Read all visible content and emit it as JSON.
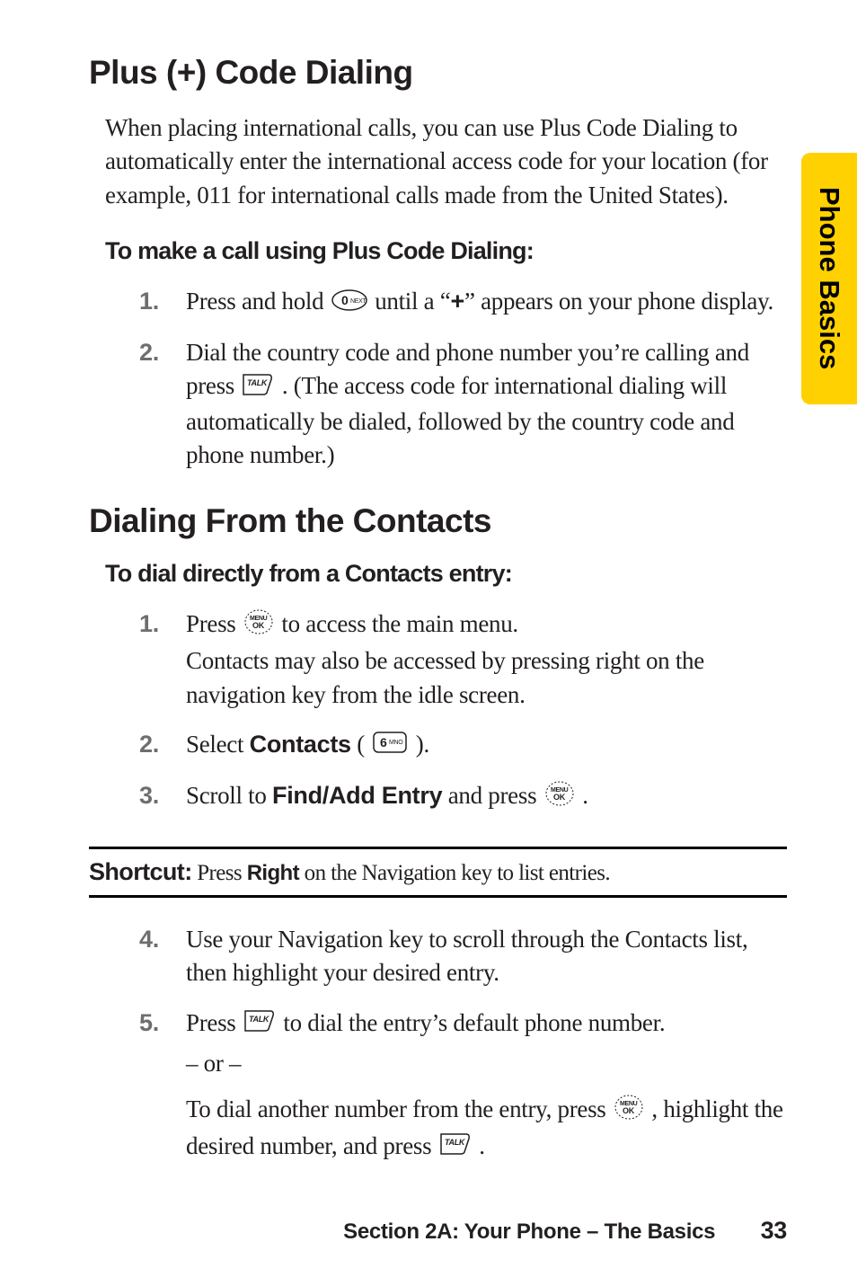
{
  "side_tab": "Phone Basics",
  "section1": {
    "title": "Plus (+) Code Dialing",
    "intro": "When placing international calls, you can use Plus Code Dialing to automatically enter the international access code for your location (for example, 011 for international calls made from the United States).",
    "lead": "To make a call using Plus Code Dialing:",
    "steps": [
      {
        "num": "1.",
        "pre": "Press and hold ",
        "post_a": " until a “",
        "plus": "+",
        "post_b": "” appears on your phone display."
      },
      {
        "num": "2.",
        "pre": "Dial the country code and phone number you’re calling and press ",
        "post": " . (The access code for international dialing will automatically be dialed, followed by the country code and phone number.)"
      }
    ]
  },
  "section2": {
    "title": "Dialing From the Contacts",
    "lead": "To dial directly from a Contacts entry:",
    "steps_a": [
      {
        "num": "1.",
        "pre": "Press ",
        "post": " to access the main menu.",
        "extra": "Contacts may also be accessed by pressing right on the navigation key from the idle screen."
      },
      {
        "num": "2.",
        "pre": "Select ",
        "bold": "Contacts",
        "mid": " ( ",
        "post": " )."
      },
      {
        "num": "3.",
        "pre": "Scroll to ",
        "bold": "Find/Add Entry",
        "mid": " and press ",
        "post": " ."
      }
    ],
    "shortcut": {
      "label": "Shortcut:",
      "pre": " Press ",
      "key": "Right",
      "post": " on the Navigation key to list entries."
    },
    "steps_b": [
      {
        "num": "4.",
        "text": "Use your Navigation key to scroll through the Contacts list, then highlight your desired entry."
      },
      {
        "num": "5.",
        "pre": "Press ",
        "post": " to dial the entry’s default phone number."
      }
    ],
    "or": "– or –",
    "tail": {
      "pre": "To dial another number from the entry, press ",
      "mid": " , highlight the desired number, and press ",
      "post": " ."
    }
  },
  "footer": {
    "text": "Section 2A: Your Phone – The Basics",
    "page": "33"
  }
}
